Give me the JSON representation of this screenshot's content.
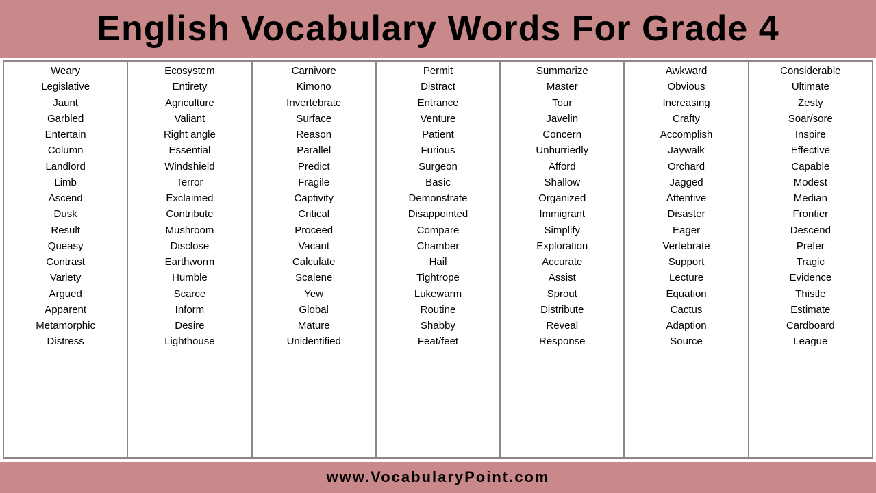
{
  "header": {
    "title": "English Vocabulary Words For Grade 4"
  },
  "columns": [
    {
      "id": "col1",
      "words": [
        "Weary",
        "Legislative",
        "Jaunt",
        "Garbled",
        "Entertain",
        "Column",
        "Landlord",
        "Limb",
        "Ascend",
        "Dusk",
        "Result",
        "Queasy",
        "Contrast",
        "Variety",
        "Argued",
        "Apparent",
        "Metamorphic",
        "Distress"
      ]
    },
    {
      "id": "col2",
      "words": [
        "Ecosystem",
        "Entirety",
        "Agriculture",
        "Valiant",
        "Right angle",
        "Essential",
        "Windshield",
        "Terror",
        "Exclaimed",
        "Contribute",
        "Mushroom",
        "Disclose",
        "Earthworm",
        "Humble",
        "Scarce",
        "Inform",
        "Desire",
        "Lighthouse"
      ]
    },
    {
      "id": "col3",
      "words": [
        "Carnivore",
        "Kimono",
        "Invertebrate",
        "Surface",
        "Reason",
        "Parallel",
        "Predict",
        "Fragile",
        "Captivity",
        "Critical",
        "Proceed",
        "Vacant",
        "Calculate",
        "Scalene",
        "Yew",
        "Global",
        "Mature",
        "Unidentified"
      ]
    },
    {
      "id": "col4",
      "words": [
        "Permit",
        "Distract",
        "Entrance",
        "Venture",
        "Patient",
        "Furious",
        "Surgeon",
        "Basic",
        "Demonstrate",
        "Disappointed",
        "Compare",
        "Chamber",
        "Hail",
        "Tightrope",
        "Lukewarm",
        "Routine",
        "Shabby",
        "Feat/feet"
      ]
    },
    {
      "id": "col5",
      "words": [
        "Summarize",
        "Master",
        "Tour",
        "Javelin",
        "Concern",
        "Unhurriedly",
        "Afford",
        "Shallow",
        "Organized",
        "Immigrant",
        "Simplify",
        "Exploration",
        "Accurate",
        "Assist",
        "Sprout",
        "Distribute",
        "Reveal",
        "Response"
      ]
    },
    {
      "id": "col6",
      "words": [
        "Awkward",
        "Obvious",
        "Increasing",
        "Crafty",
        "Accomplish",
        "Jaywalk",
        "Orchard",
        "Jagged",
        "Attentive",
        "Disaster",
        "Eager",
        "Vertebrate",
        "Support",
        "Lecture",
        "Equation",
        "Cactus",
        "Adaption",
        "Source"
      ]
    },
    {
      "id": "col7",
      "words": [
        "Considerable",
        "Ultimate",
        "Zesty",
        "Soar/sore",
        "Inspire",
        "Effective",
        "Capable",
        "Modest",
        "Median",
        "Frontier",
        "Descend",
        "Prefer",
        "Tragic",
        "Evidence",
        "Thistle",
        "Estimate",
        "Cardboard",
        "League"
      ]
    }
  ],
  "footer": {
    "text": "www.VocabularyPoint.com"
  }
}
